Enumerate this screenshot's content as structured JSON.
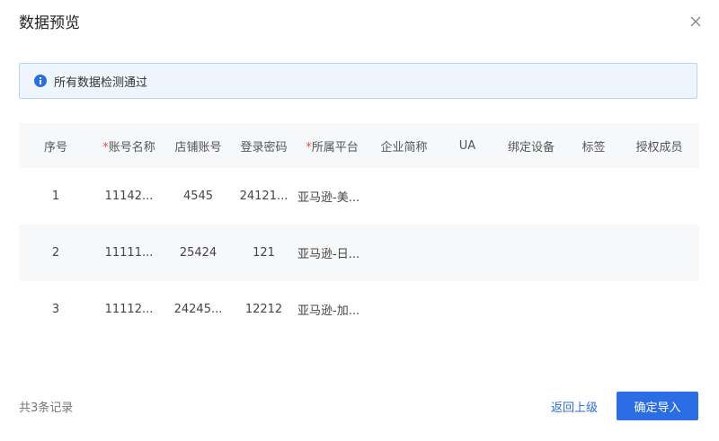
{
  "dialog": {
    "title": "数据预览",
    "close_icon": "close-icon"
  },
  "alert": {
    "icon": "info-icon",
    "text": "所有数据检测通过",
    "accent": "#2b6de5"
  },
  "table": {
    "columns": [
      {
        "label": "序号",
        "required": false
      },
      {
        "label": "账号名称",
        "required": true
      },
      {
        "label": "店铺账号",
        "required": false
      },
      {
        "label": "登录密码",
        "required": false
      },
      {
        "label": "所属平台",
        "required": true
      },
      {
        "label": "企业简称",
        "required": false
      },
      {
        "label": "UA",
        "required": false
      },
      {
        "label": "绑定设备",
        "required": false
      },
      {
        "label": "标签",
        "required": false
      },
      {
        "label": "授权成员",
        "required": false
      }
    ],
    "required_mark": "*",
    "rows": [
      [
        "1",
        "11142...",
        "4545",
        "24121...",
        "亚马逊-美...",
        "",
        "",
        "",
        "",
        ""
      ],
      [
        "2",
        "11111...",
        "25424",
        "121",
        "亚马逊-日...",
        "",
        "",
        "",
        "",
        ""
      ],
      [
        "3",
        "11112...",
        "24245...",
        "12212",
        "亚马逊-加...",
        "",
        "",
        "",
        "",
        ""
      ]
    ]
  },
  "footer": {
    "count_text": "共3条记录",
    "back_label": "返回上级",
    "confirm_label": "确定导入"
  }
}
